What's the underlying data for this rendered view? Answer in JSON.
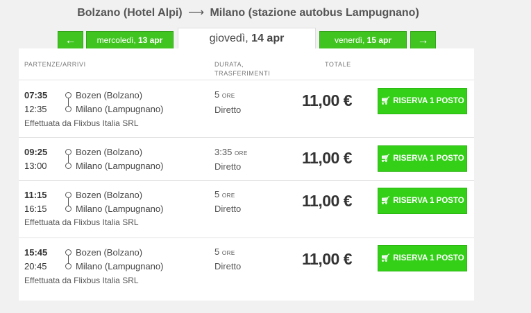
{
  "header": {
    "origin": "Bolzano (Hotel Alpi)",
    "arrow": "⟶",
    "destination": "Milano (stazione autobus Lampugnano)"
  },
  "date_nav": {
    "prev_arrow": "←",
    "next_arrow": "→",
    "days": [
      {
        "weekday": "mercoledì,",
        "date": "13 apr"
      },
      {
        "weekday": "giovedì,",
        "date": "14 apr"
      },
      {
        "weekday": "venerdì,",
        "date": "15 apr"
      }
    ]
  },
  "table": {
    "col_departures": "PARTENZE/ARRIVI",
    "col_duration_line1": "DURATA,",
    "col_duration_line2": "TRASFERIMENTI",
    "col_total": "TOTALE"
  },
  "trips": [
    {
      "dep_time": "07:35",
      "arr_time": "12:35",
      "from": "Bozen (Bolzano)",
      "to": "Milano (Lampugnano)",
      "operator": "Effettuata da Flixbus Italia SRL",
      "duration": "5",
      "duration_unit": "ORE",
      "transfers": "Diretto",
      "price": "11,00 €",
      "button": "RISERVA 1 POSTO"
    },
    {
      "dep_time": "09:25",
      "arr_time": "13:00",
      "from": "Bozen (Bolzano)",
      "to": "Milano (Lampugnano)",
      "operator": "",
      "duration": "3:35",
      "duration_unit": "ORE",
      "transfers": "Diretto",
      "price": "11,00 €",
      "button": "RISERVA 1 POSTO"
    },
    {
      "dep_time": "11:15",
      "arr_time": "16:15",
      "from": "Bozen (Bolzano)",
      "to": "Milano (Lampugnano)",
      "operator": "Effettuata da Flixbus Italia SRL",
      "duration": "5",
      "duration_unit": "ORE",
      "transfers": "Diretto",
      "price": "11,00 €",
      "button": "RISERVA 1 POSTO"
    },
    {
      "dep_time": "15:45",
      "arr_time": "20:45",
      "from": "Bozen (Bolzano)",
      "to": "Milano (Lampugnano)",
      "operator": "Effettuata da Flixbus Italia SRL",
      "duration": "5",
      "duration_unit": "ORE",
      "transfers": "Diretto",
      "price": "11,00 €",
      "button": "RISERVA 1 POSTO"
    }
  ],
  "colors": {
    "accent_green": "#33d017",
    "tab_green": "#40c520",
    "page_bg": "#f1f1f1"
  }
}
